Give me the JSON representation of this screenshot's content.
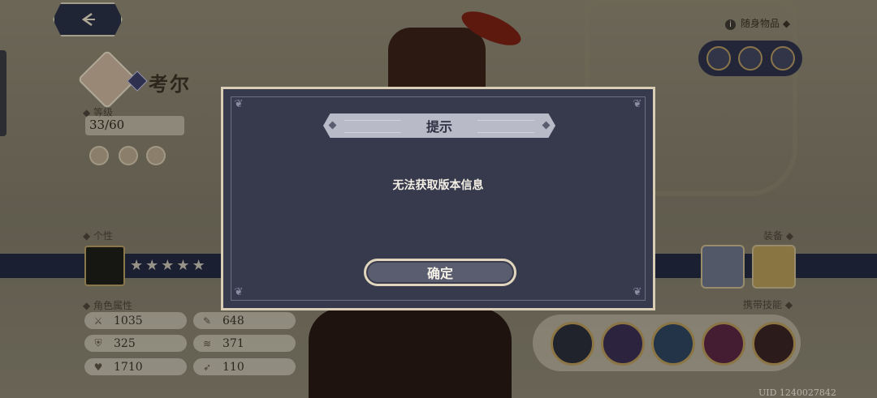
{
  "character": {
    "name": "考尔",
    "level_label": "等级",
    "level_value": "33/60",
    "personality_label": "个性",
    "stars": "★★★★★",
    "attributes_label": "角色属性",
    "stats": [
      {
        "icon": "attack-icon",
        "value": "1035"
      },
      {
        "icon": "crit-icon",
        "value": "648"
      },
      {
        "icon": "defense-icon",
        "value": "325"
      },
      {
        "icon": "speed-icon",
        "value": "371"
      },
      {
        "icon": "hp-icon",
        "value": "1710"
      },
      {
        "icon": "dodge-icon",
        "value": "110"
      }
    ]
  },
  "right_panel": {
    "carry_items_title": "随身物品",
    "equipment_label": "装备",
    "skills_label": "携带技能"
  },
  "uid_text": "UID 1240027842",
  "dialog": {
    "title": "提示",
    "message": "无法获取版本信息",
    "confirm_label": "确定"
  },
  "colors": {
    "dialog_bg": "#373a4c",
    "dialog_border": "#d9ceb5",
    "banner_bg": "#b9bac8",
    "band_navy": "#232a41"
  }
}
